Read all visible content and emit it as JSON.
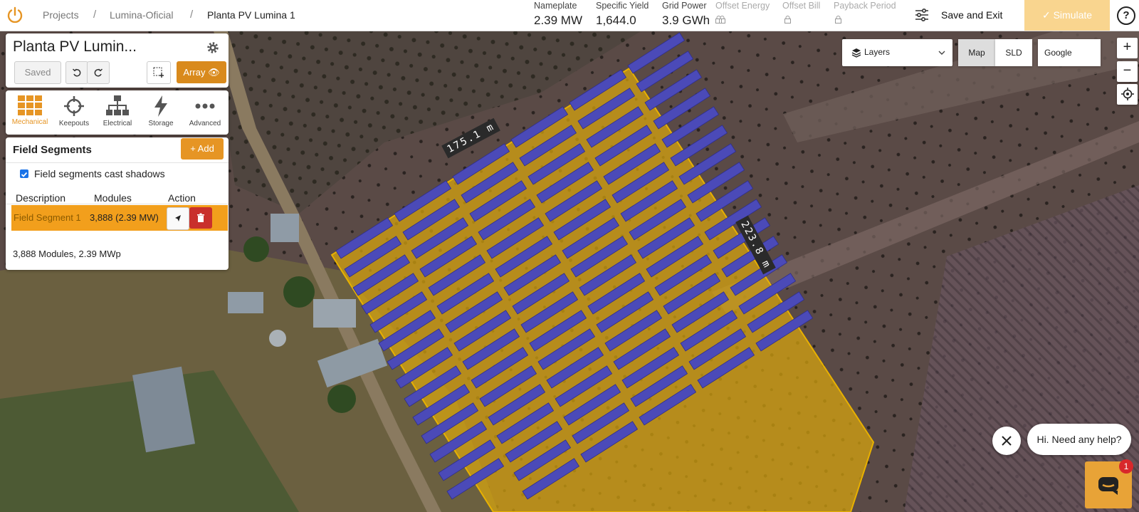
{
  "breadcrumb": [
    "Projects",
    "Lumina-Oficial",
    "Planta PV Lumina 1"
  ],
  "metrics": [
    {
      "label": "Nameplate",
      "value": "2.39 MW",
      "locked": false
    },
    {
      "label": "Specific Yield",
      "value": "1,644.0",
      "locked": false
    },
    {
      "label": "Grid Power",
      "value": "3.9 GWh",
      "locked": true
    },
    {
      "label": "Offset Energy",
      "value": "",
      "locked": true
    },
    {
      "label": "Offset Bill",
      "value": "",
      "locked": true
    },
    {
      "label": "Payback Period",
      "value": "",
      "locked": true
    }
  ],
  "toolbar": {
    "save_exit": "Save and Exit",
    "simulate": "Simulate",
    "help": "?"
  },
  "project_panel": {
    "title": "Planta PV Lumin...",
    "saved_label": "Saved",
    "array_label": "Array"
  },
  "tools": [
    {
      "label": "Mechanical",
      "icon": "grid-icon",
      "active": true
    },
    {
      "label": "Keepouts",
      "icon": "crosshair-icon",
      "active": false
    },
    {
      "label": "Electrical",
      "icon": "hierarchy-icon",
      "active": false
    },
    {
      "label": "Storage",
      "icon": "bolt-icon",
      "active": false
    },
    {
      "label": "Advanced",
      "icon": "ellipsis-icon",
      "active": false
    }
  ],
  "field_segments": {
    "title": "Field Segments",
    "add_label": "+ Add",
    "shadow_label": "Field segments cast shadows",
    "shadow_checked": true,
    "columns": [
      "Description",
      "Modules",
      "Action"
    ],
    "rows": [
      {
        "description": "Field Segment 1",
        "modules": "3,888 (2.39 MW)"
      }
    ],
    "summary": "3,888 Modules, 2.39 MWp"
  },
  "map_controls": {
    "layers_label": "Layers",
    "map_tab": "Map",
    "sld_tab": "SLD",
    "provider": "Google",
    "zoom_in": "+",
    "zoom_out": "−"
  },
  "dimensions": {
    "top_edge": "175.1 m",
    "right_edge": "223.8 m"
  },
  "chat": {
    "message": "Hi. Need any help?",
    "badge": "1"
  },
  "colors": {
    "accent": "#e69524",
    "segment_fill": "#d9a60d",
    "module": "#4b4ab8",
    "danger": "#c9302c"
  }
}
